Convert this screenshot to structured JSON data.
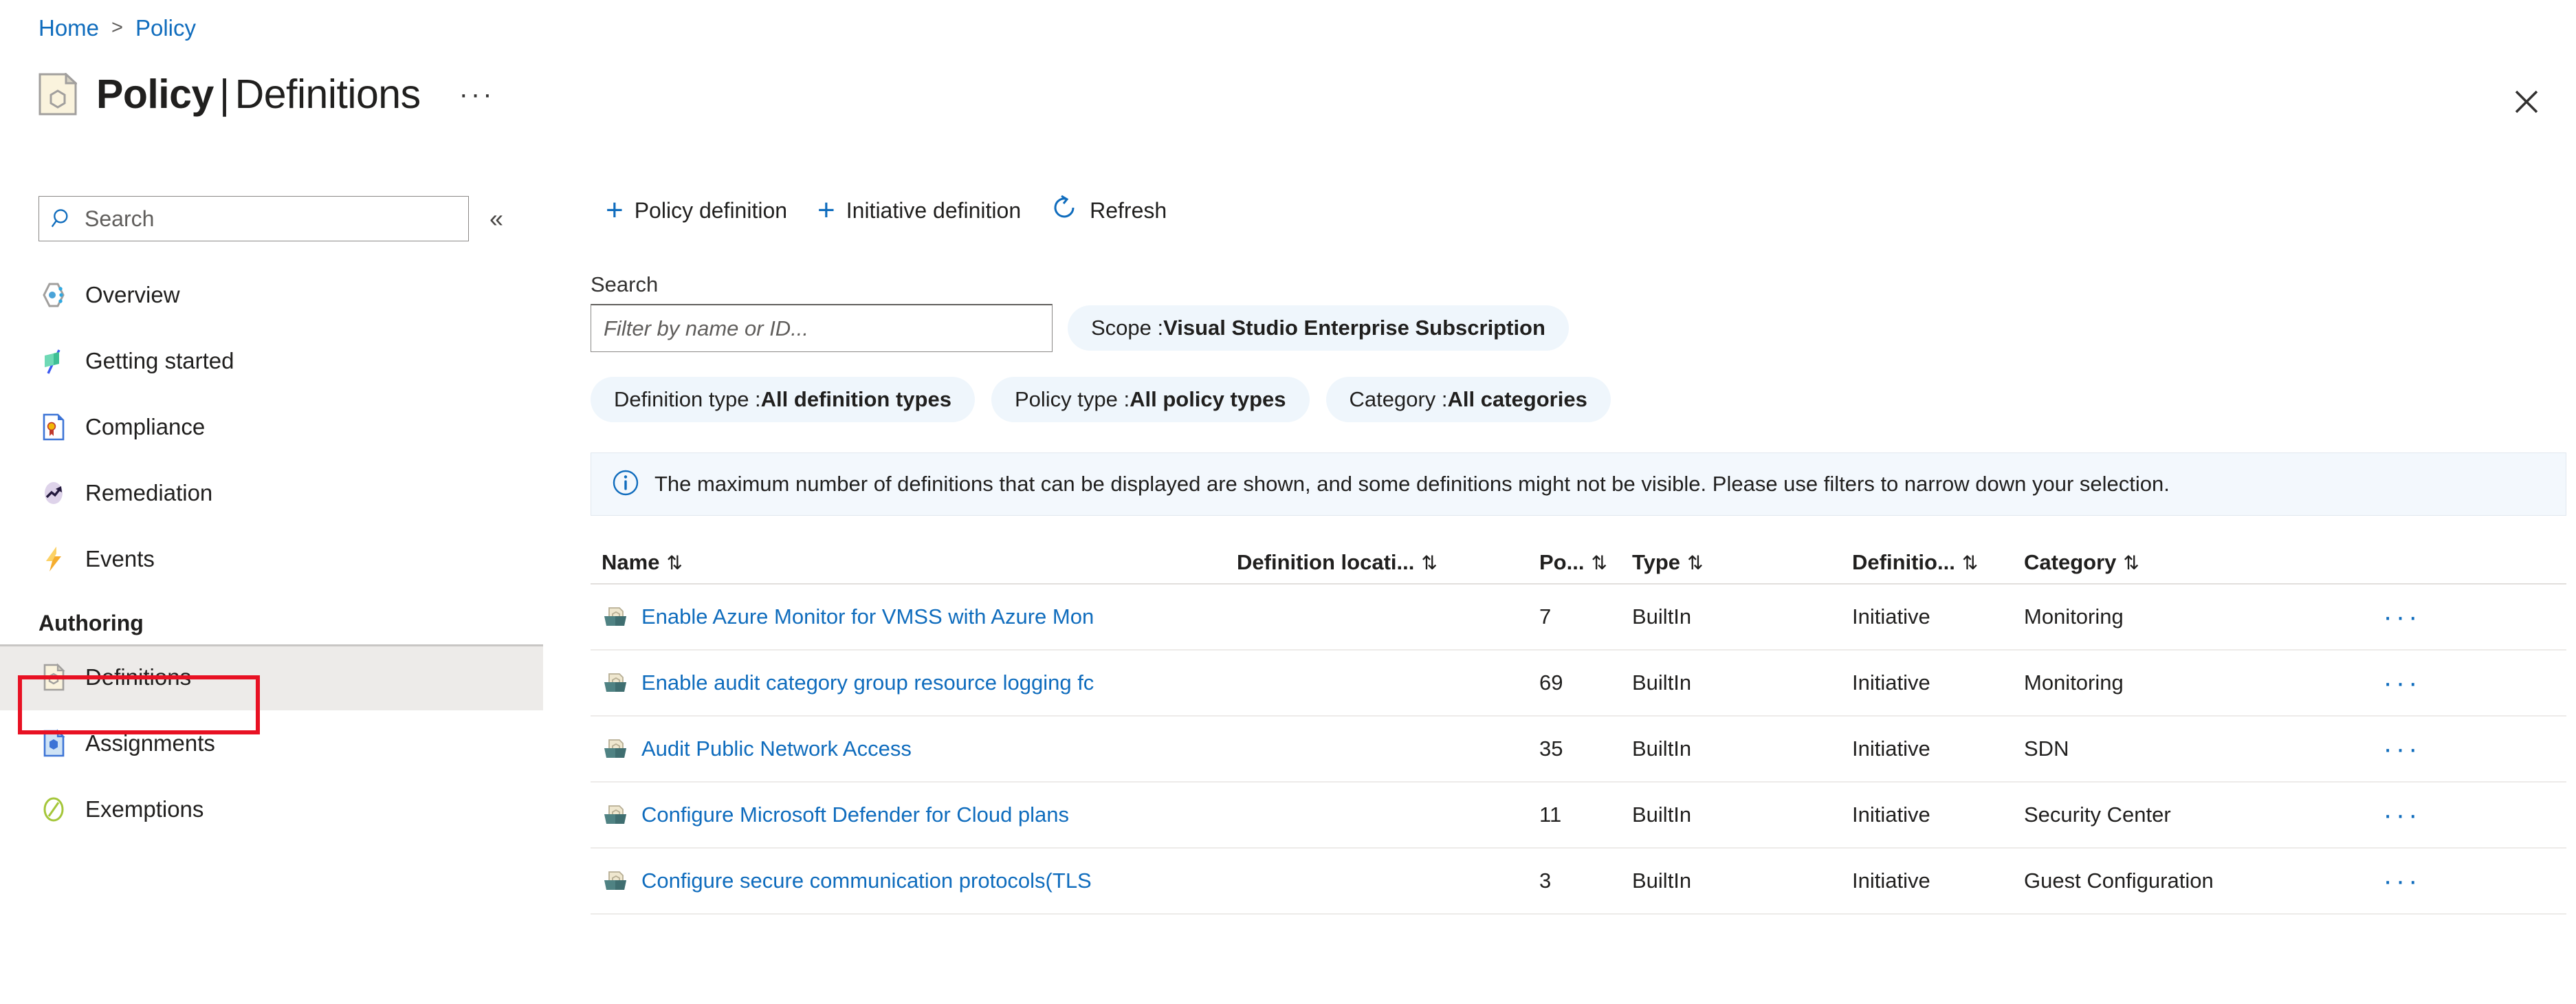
{
  "breadcrumb": {
    "home": "Home",
    "separator": ">",
    "current": "Policy"
  },
  "header": {
    "title_main": "Policy",
    "title_separator": "|",
    "title_sub": "Definitions",
    "ellipsis": "···",
    "close": "✕"
  },
  "sidebar": {
    "search_placeholder": "Search",
    "collapse": "«",
    "items": [
      {
        "label": "Overview",
        "icon": "policy-overview-icon"
      },
      {
        "label": "Getting started",
        "icon": "flag-icon"
      },
      {
        "label": "Compliance",
        "icon": "compliance-document-icon"
      },
      {
        "label": "Remediation",
        "icon": "remediation-trend-icon"
      },
      {
        "label": "Events",
        "icon": "lightning-bolt-icon"
      }
    ],
    "section_label": "Authoring",
    "authoring_items": [
      {
        "label": "Definitions",
        "icon": "definitions-icon",
        "selected": true
      },
      {
        "label": "Assignments",
        "icon": "assignments-icon",
        "selected": false
      },
      {
        "label": "Exemptions",
        "icon": "exemptions-icon",
        "selected": false
      }
    ]
  },
  "toolbar": {
    "policy_definition": "Policy definition",
    "initiative_definition": "Initiative definition",
    "refresh": "Refresh",
    "plus": "+"
  },
  "filters": {
    "search_label": "Search",
    "search_placeholder": "Filter by name or ID...",
    "scope_label": "Scope : ",
    "scope_value": "Visual Studio Enterprise Subscription",
    "definition_type_label": "Definition type : ",
    "definition_type_value": "All definition types",
    "policy_type_label": "Policy type : ",
    "policy_type_value": "All policy types",
    "category_label": "Category : ",
    "category_value": "All categories"
  },
  "info_banner": {
    "icon": "info-icon",
    "text": "The maximum number of definitions that can be displayed are shown, and some definitions might not be visible. Please use filters to narrow down your selection."
  },
  "table": {
    "sort_icon": "⇅",
    "columns": [
      "Name",
      "Definition locati...",
      "Po...",
      "Type",
      "Definitio...",
      "Category"
    ],
    "rows": [
      {
        "name": "Enable Azure Monitor for VMSS with Azure Mon",
        "definition_location": "",
        "policies": "7",
        "type": "BuiltIn",
        "definition_type": "Initiative",
        "category": "Monitoring",
        "menu": "···"
      },
      {
        "name": "Enable audit category group resource logging fc",
        "definition_location": "",
        "policies": "69",
        "type": "BuiltIn",
        "definition_type": "Initiative",
        "category": "Monitoring",
        "menu": "···"
      },
      {
        "name": "Audit Public Network Access",
        "definition_location": "",
        "policies": "35",
        "type": "BuiltIn",
        "definition_type": "Initiative",
        "category": "SDN",
        "menu": "···"
      },
      {
        "name": "Configure Microsoft Defender for Cloud plans",
        "definition_location": "",
        "policies": "11",
        "type": "BuiltIn",
        "definition_type": "Initiative",
        "category": "Security Center",
        "menu": "···"
      },
      {
        "name": "Configure secure communication protocols(TLS",
        "definition_location": "",
        "policies": "3",
        "type": "BuiltIn",
        "definition_type": "Initiative",
        "category": "Guest Configuration",
        "menu": "···"
      }
    ]
  },
  "colors": {
    "link": "#0f6cbd",
    "pill_bg": "#eff6fc",
    "banner_bg": "#f3f8fd",
    "selected_bg": "#edebe9",
    "highlight": "#e81123"
  }
}
